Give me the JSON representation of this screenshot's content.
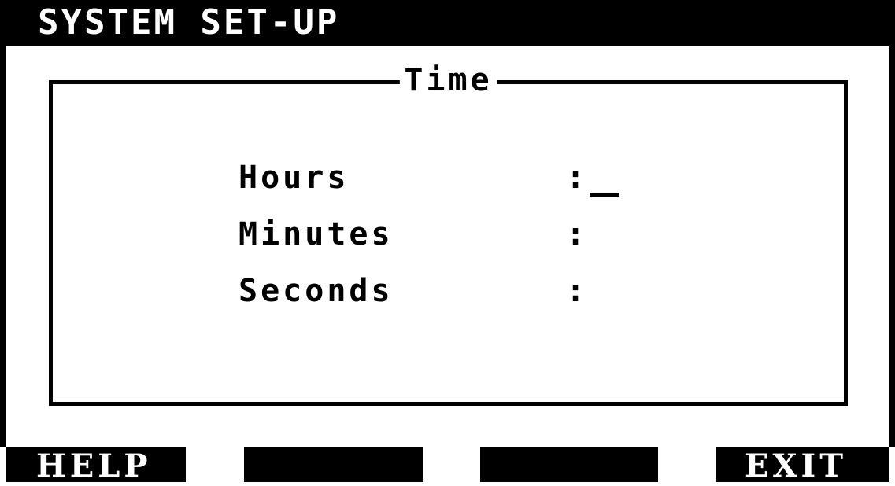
{
  "window": {
    "title": "SYSTEM SET-UP"
  },
  "frame": {
    "title": "Time"
  },
  "fields": [
    {
      "label": "Hours",
      "colon": ":",
      "value": "",
      "active": true
    },
    {
      "label": "Minutes",
      "colon": ":",
      "value": ""
    },
    {
      "label": "Seconds",
      "colon": ":",
      "value": ""
    }
  ],
  "function_keys": [
    {
      "label": "HELP"
    },
    {
      "label": ""
    },
    {
      "label": ""
    },
    {
      "label": "EXIT"
    }
  ],
  "colors": {
    "foreground": "#000000",
    "background": "#ffffff"
  }
}
